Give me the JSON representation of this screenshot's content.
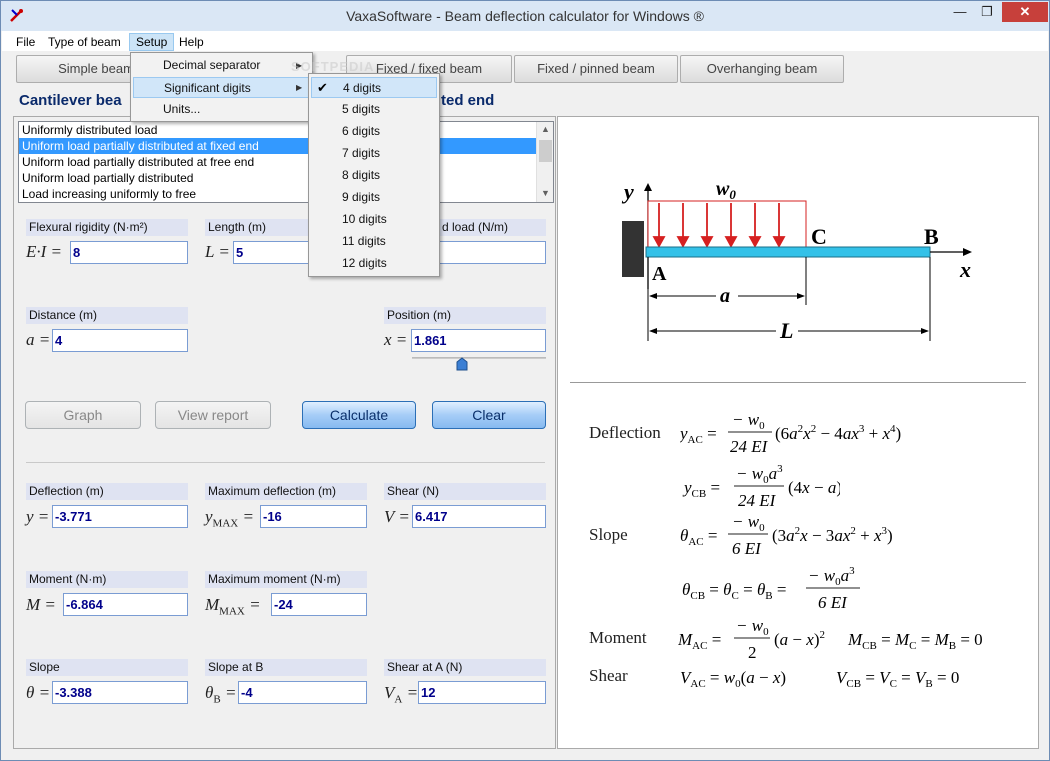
{
  "window": {
    "title": "VaxaSoftware - Beam deflection calculator for Windows ®"
  },
  "menu": {
    "file": "File",
    "type_of_beam": "Type of beam",
    "setup": "Setup",
    "help": "Help"
  },
  "setup_menu": {
    "decimal_separator": "Decimal separator",
    "significant_digits": "Significant digits",
    "units": "Units..."
  },
  "digits_menu": [
    "4 digits",
    "5 digits",
    "6 digits",
    "7 digits",
    "8 digits",
    "9 digits",
    "10 digits",
    "11 digits",
    "12 digits"
  ],
  "tabs": [
    "Simple beam",
    "Fixed / fixed beam",
    "Fixed / pinned beam",
    "Overhanging beam"
  ],
  "beam_title_left": "Cantilever bea",
  "beam_title_right": "ted end",
  "watermark": "SOFTPEDIA",
  "load_list": [
    "Uniformly distributed load",
    "Uniform load partially distributed at fixed end",
    "Uniform load partially distributed at free end",
    "Uniform load partially distributed",
    "Load increasing uniformly to free"
  ],
  "inputs": {
    "flexural_label": "Flexural rigidity (N·m²)",
    "flexural_var": "E·I =",
    "flexural_value": "8",
    "length_label": "Length (m)",
    "length_var": "L =",
    "length_value": "5",
    "load_label": "d load (N/m)",
    "distance_label": "Distance (m)",
    "distance_var": "a =",
    "distance_value": "4",
    "position_label": "Position (m)",
    "position_var": "x =",
    "position_value": "1.861"
  },
  "buttons": {
    "graph": "Graph",
    "view_report": "View report",
    "calculate": "Calculate",
    "clear": "Clear"
  },
  "results": {
    "deflection_label": "Deflection (m)",
    "deflection_var": "y =",
    "deflection_value": "-3.771",
    "max_deflection_label": "Maximum deflection (m)",
    "max_deflection_var": "y",
    "max_deflection_sub": "MAX",
    "max_deflection_value": "-16",
    "shear_label": "Shear (N)",
    "shear_var": "V =",
    "shear_value": "6.417",
    "moment_label": "Moment (N·m)",
    "moment_var": "M =",
    "moment_value": "-6.864",
    "max_moment_label": "Maximum moment (N·m)",
    "max_moment_var": "M",
    "max_moment_sub": "MAX",
    "max_moment_value": "-24",
    "slope_label": "Slope",
    "slope_var": "θ =",
    "slope_value": "-3.388",
    "slope_b_label": "Slope at B",
    "slope_b_var": "θ",
    "slope_b_sub": "B",
    "slope_b_value": "-4",
    "shear_a_label": "Shear at A (N)",
    "shear_a_var": "V",
    "shear_a_sub": "A",
    "shear_a_value": "12"
  },
  "diagram": {
    "y": "y",
    "w0": "w",
    "w0_sub": "0",
    "c": "C",
    "b": "B",
    "a_point": "A",
    "x": "x",
    "a_dim": "a",
    "l_dim": "L"
  },
  "formulas": {
    "deflection_label": "Deflection",
    "slope_label": "Slope",
    "moment_label": "Moment",
    "shear_label": "Shear"
  },
  "colors": {
    "beam": "#33c1e8",
    "load_arrows": "#d62020",
    "accent": "#0a2a6b"
  }
}
